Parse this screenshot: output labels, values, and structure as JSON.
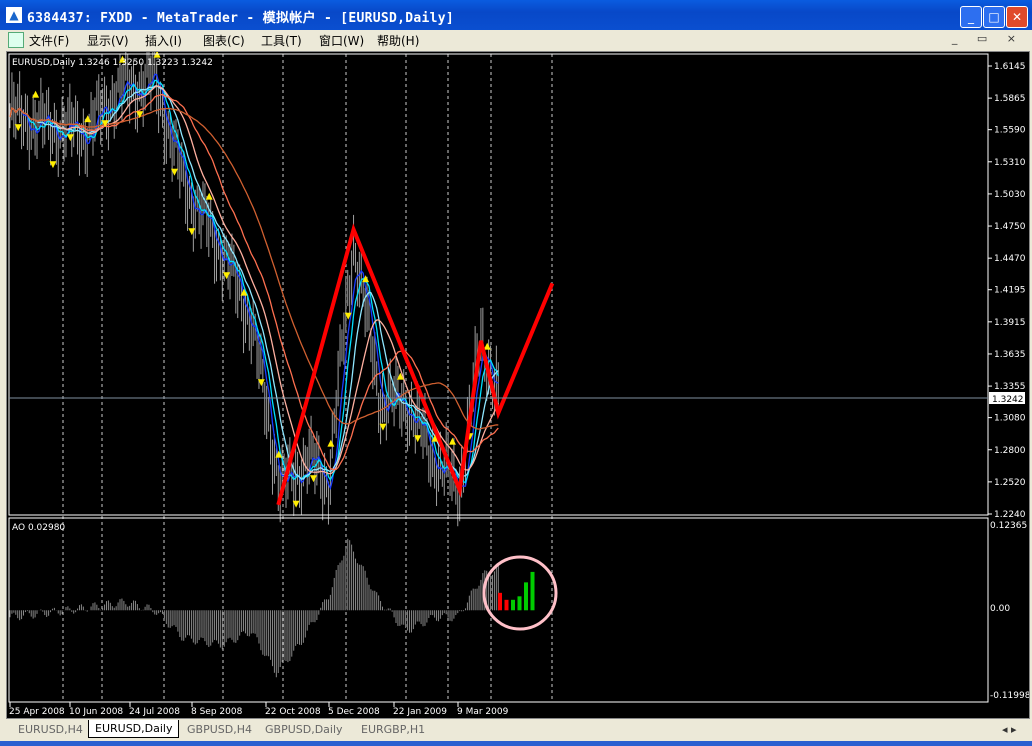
{
  "window": {
    "title": "6384437: FXDD - MetaTrader - 模拟帐户 - [EURUSD,Daily]",
    "min": "_",
    "max": "□",
    "close": "✕"
  },
  "menu": [
    "文件(F)",
    "显示(V)",
    "插入(I)",
    "图表(C)",
    "工具(T)",
    "窗口(W)",
    "帮助(H)"
  ],
  "mdi_controls": "_ ▭ ×",
  "chart": {
    "header": "EURUSD,Daily  1.3246 1.3250 1.3223 1.3242",
    "current_price": "1.3242",
    "indicator_header": "AO 0.02980",
    "price_ticks": [
      "1.6145",
      "1.5865",
      "1.5590",
      "1.5310",
      "1.5030",
      "1.4750",
      "1.4470",
      "1.4195",
      "1.3915",
      "1.3635",
      "1.3355",
      "1.3080",
      "1.2800",
      "1.2520",
      "1.2240"
    ],
    "ao_ticks": [
      "0.12365",
      "0.00",
      "-0.11998"
    ],
    "date_labels": [
      "25 Apr 2008",
      "10 Jun 2008",
      "24 Jul 2008",
      "8 Sep 2008",
      "22 Oct 2008",
      "5 Dec 2008",
      "22 Jan 2009",
      "9 Mar 2009"
    ]
  },
  "chart_data": {
    "type": "line",
    "symbol": "EURUSD",
    "timeframe": "Daily",
    "ylim": [
      1.224,
      1.6145
    ],
    "ao_ylim": [
      -0.11998,
      0.12365
    ],
    "price_keypoints": [
      [
        0,
        1.57
      ],
      [
        20,
        1.56
      ],
      [
        40,
        1.555
      ],
      [
        55,
        1.59
      ],
      [
        75,
        1.6
      ],
      [
        90,
        1.51
      ],
      [
        110,
        1.45
      ],
      [
        125,
        1.39
      ],
      [
        140,
        1.245
      ],
      [
        155,
        1.27
      ],
      [
        165,
        1.25
      ],
      [
        178,
        1.46
      ],
      [
        192,
        1.32
      ],
      [
        205,
        1.32
      ],
      [
        220,
        1.27
      ],
      [
        233,
        1.245
      ],
      [
        244,
        1.375
      ],
      [
        253,
        1.3242
      ]
    ],
    "zigzag": [
      [
        139,
        1.232
      ],
      [
        178,
        1.472
      ],
      [
        233,
        1.245
      ],
      [
        244,
        1.375
      ],
      [
        253,
        1.312
      ],
      [
        281,
        1.425
      ]
    ],
    "ao_keypoints": [
      [
        0,
        -0.01
      ],
      [
        30,
        0.0
      ],
      [
        60,
        0.012
      ],
      [
        75,
        0.0
      ],
      [
        90,
        -0.04
      ],
      [
        110,
        -0.05
      ],
      [
        125,
        -0.03
      ],
      [
        138,
        -0.09
      ],
      [
        150,
        -0.05
      ],
      [
        165,
        0.02
      ],
      [
        175,
        0.1
      ],
      [
        190,
        0.02
      ],
      [
        205,
        -0.03
      ],
      [
        220,
        -0.01
      ],
      [
        232,
        -0.01
      ],
      [
        245,
        0.05
      ],
      [
        253,
        0.06
      ]
    ],
    "ao_highlight": {
      "values": [
        0.025,
        0.015,
        0.015,
        0.02,
        0.04,
        0.055
      ],
      "colors": [
        "red",
        "red",
        "green",
        "green",
        "green",
        "green"
      ]
    },
    "colors": {
      "zigzag": "#ff0000",
      "ao_up": "#00cc00",
      "ao_down": "#ff0000",
      "bars": "#a0a0a0",
      "highlight_circle": "#ffc0c8"
    }
  },
  "tabs": [
    {
      "label": "EURUSD,H4",
      "active": false
    },
    {
      "label": "EURUSD,Daily",
      "active": true
    },
    {
      "label": "GBPUSD,H4",
      "active": false
    },
    {
      "label": "GBPUSD,Daily",
      "active": false
    },
    {
      "label": "EURGBP,H1",
      "active": false
    }
  ]
}
